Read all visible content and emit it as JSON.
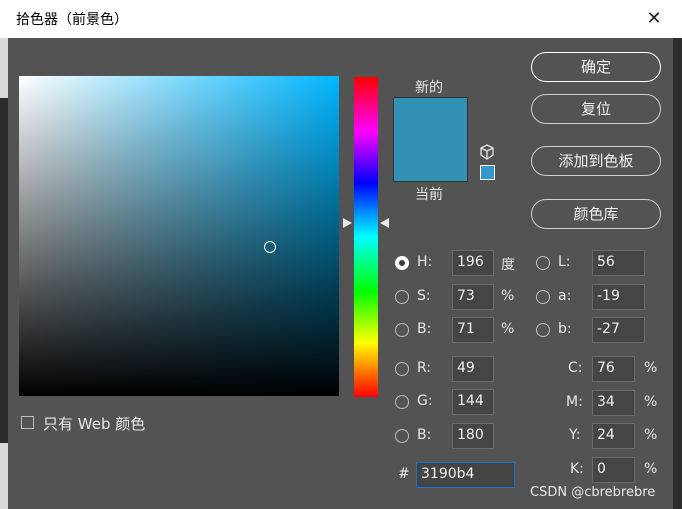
{
  "window": {
    "title": "拾色器（前景色）",
    "close_glyph": "✕"
  },
  "color": {
    "hex_value": "#3190b4"
  },
  "swatches": {
    "new_label": "新的",
    "current_label": "当前"
  },
  "buttons": {
    "ok": "确定",
    "reset": "复位",
    "add_to_swatches": "添加到色板",
    "color_libraries": "颜色库"
  },
  "web_only": {
    "label": "只有 Web 颜色",
    "checked": false
  },
  "hsb": {
    "h": {
      "label": "H:",
      "value": "196",
      "unit": "度"
    },
    "s": {
      "label": "S:",
      "value": "73",
      "unit": "%"
    },
    "b": {
      "label": "B:",
      "value": "71",
      "unit": "%"
    }
  },
  "rgb": {
    "r": {
      "label": "R:",
      "value": "49"
    },
    "g": {
      "label": "G:",
      "value": "144"
    },
    "b": {
      "label": "B:",
      "value": "180"
    }
  },
  "lab": {
    "l": {
      "label": "L:",
      "value": "56"
    },
    "a": {
      "label": "a:",
      "value": "-19"
    },
    "b": {
      "label": "b:",
      "value": "-27"
    }
  },
  "cmyk": {
    "c": {
      "label": "C:",
      "value": "76",
      "unit": "%"
    },
    "m": {
      "label": "M:",
      "value": "34",
      "unit": "%"
    },
    "y": {
      "label": "Y:",
      "value": "24",
      "unit": "%"
    },
    "k": {
      "label": "K:",
      "value": "0",
      "unit": "%"
    }
  },
  "hex": {
    "label": "#",
    "value": "3190b4"
  },
  "watermark": "CSDN @cbrebrebre"
}
